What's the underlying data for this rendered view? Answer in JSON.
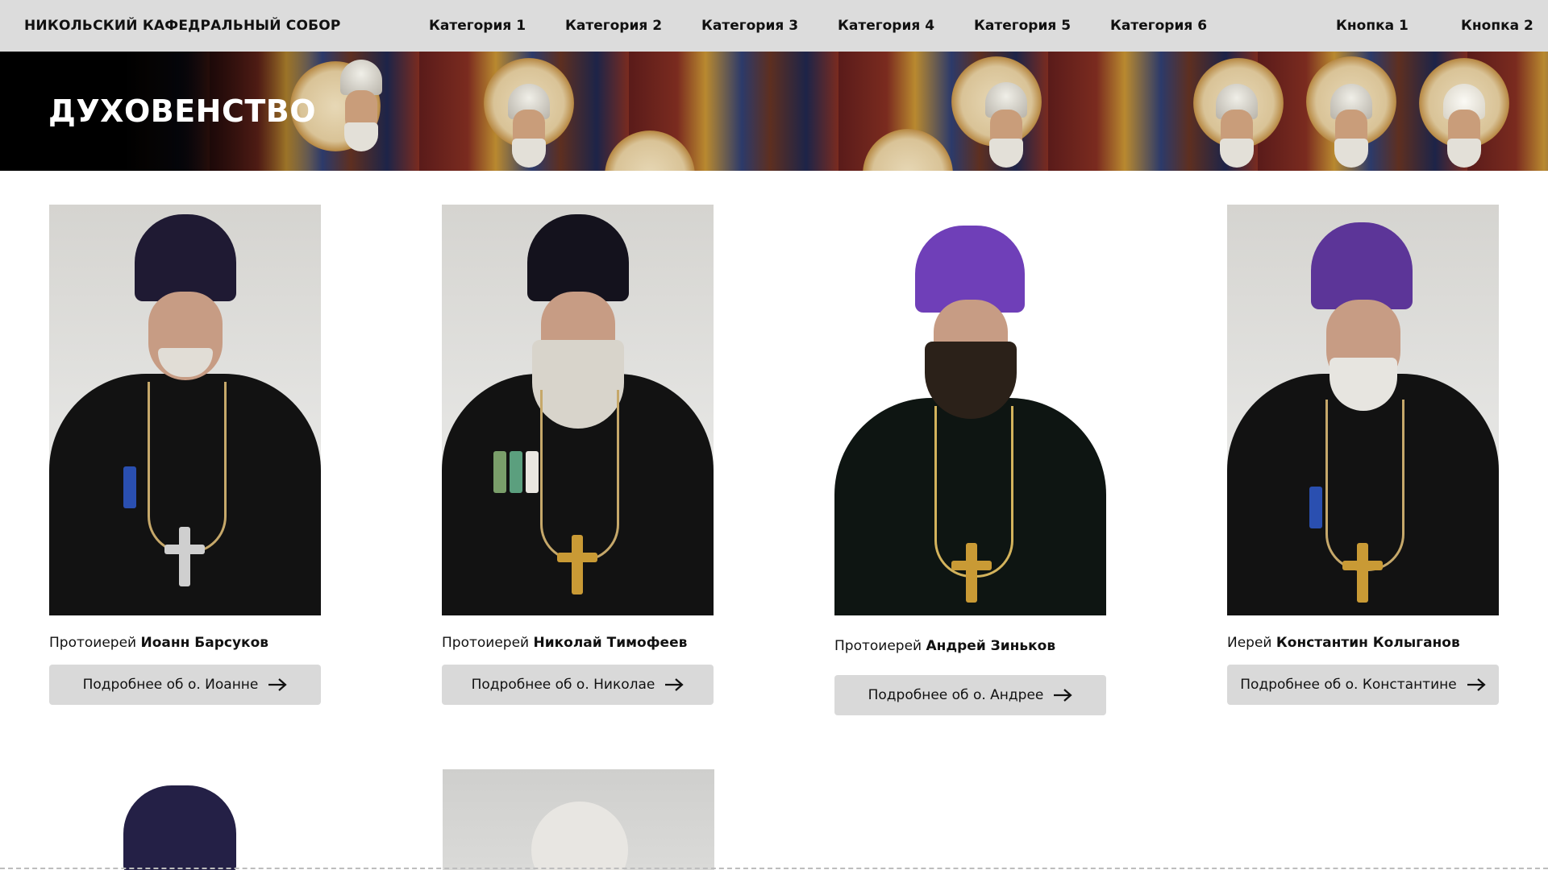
{
  "header": {
    "brand": "НИКОЛЬСКИЙ КАФЕДРАЛЬНЫЙ СОБОР",
    "categories": [
      "Категория 1",
      "Категория 2",
      "Категория 3",
      "Категория 4",
      "Категория 5",
      "Категория 6"
    ],
    "buttons": [
      "Кнопка 1",
      "Кнопка 2"
    ]
  },
  "banner": {
    "title": "ДУХОВЕНСТВО"
  },
  "clergy": [
    {
      "rank": "Протоиерей",
      "name": "Иоанн Барсуков",
      "button": "Подробнее об о. Иоанне"
    },
    {
      "rank": "Протоиерей",
      "name": "Николай Тимофеев",
      "button": "Подробнее об о. Николае"
    },
    {
      "rank": "Протоиерей",
      "name": "Андрей Зиньков",
      "button": "Подробнее об о. Андрее"
    },
    {
      "rank": "Иерей",
      "name": "Константин Колыганов",
      "button": "Подробнее об о. Константине"
    }
  ],
  "icons": {
    "button_arrow": "arrow-right-icon"
  },
  "colors": {
    "navbar_bg": "#dcdcdc",
    "button_bg": "#d9d9d9",
    "title_text": "#ffffff",
    "kamilavka_black": "#1a1628",
    "kamilavka_purple": "#6f3fb8"
  }
}
